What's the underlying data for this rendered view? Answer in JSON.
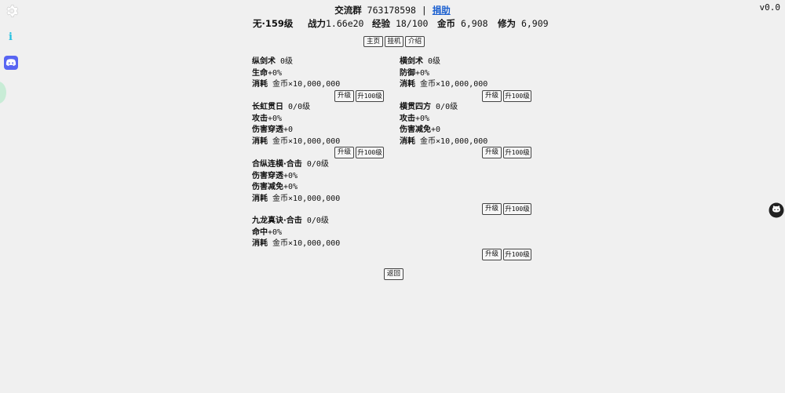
{
  "header": {
    "group_label": "交流群",
    "group_number": "763178598",
    "separator": "|",
    "donate_link": "捐助",
    "version": "v0.0"
  },
  "stats": {
    "realm": "无·159级",
    "power_label": "战力",
    "power_value": "1.66e20",
    "exp_label": "经验",
    "exp_value": "18/100",
    "gold_label": "金币",
    "gold_value": "6,908",
    "cultivation_label": "修为",
    "cultivation_value": "6,909"
  },
  "nav": {
    "home": "主页",
    "idle": "挂机",
    "intro": "介绍"
  },
  "skills": [
    {
      "name": "纵剑术",
      "level": "0级",
      "effects": [
        {
          "label": "生命",
          "value": "+0%"
        }
      ],
      "cost_label": "消耗",
      "cost": "金币×10,000,000"
    },
    {
      "name": "横剑术",
      "level": "0级",
      "effects": [
        {
          "label": "防御",
          "value": "+0%"
        }
      ],
      "cost_label": "消耗",
      "cost": "金币×10,000,000"
    },
    {
      "name": "长虹贯日",
      "level": "0/0级",
      "effects": [
        {
          "label": "攻击",
          "value": "+0%"
        },
        {
          "label": "伤害穿透",
          "value": "+0"
        }
      ],
      "cost_label": "消耗",
      "cost": "金币×10,000,000"
    },
    {
      "name": "横贯四方",
      "level": "0/0级",
      "effects": [
        {
          "label": "攻击",
          "value": "+0%"
        },
        {
          "label": "伤害减免",
          "value": "+0"
        }
      ],
      "cost_label": "消耗",
      "cost": "金币×10,000,000"
    },
    {
      "name": "合纵连横·合击",
      "level": "0/0级",
      "effects": [
        {
          "label": "伤害穿透",
          "value": "+0%"
        },
        {
          "label": "伤害减免",
          "value": "+0%"
        }
      ],
      "cost_label": "消耗",
      "cost": "金币×10,000,000"
    },
    {
      "name": "九龙真诀·合击",
      "level": "0/0级",
      "effects": [
        {
          "label": "命中",
          "value": "+0%"
        }
      ],
      "cost_label": "消耗",
      "cost": "金币×10,000,000"
    }
  ],
  "buttons": {
    "upgrade": "升级",
    "upgrade100_prefix": "升",
    "upgrade100_num": "100",
    "upgrade100_suffix": "级",
    "back": "返回"
  },
  "icons": {
    "settings": "gear-icon",
    "info": "info-icon",
    "discord": "discord-icon",
    "github": "github-icon"
  },
  "colors": {
    "background": "#f0f0f0",
    "link": "#1a5fd0",
    "info": "#23c0e0",
    "discord": "#5865f2"
  }
}
